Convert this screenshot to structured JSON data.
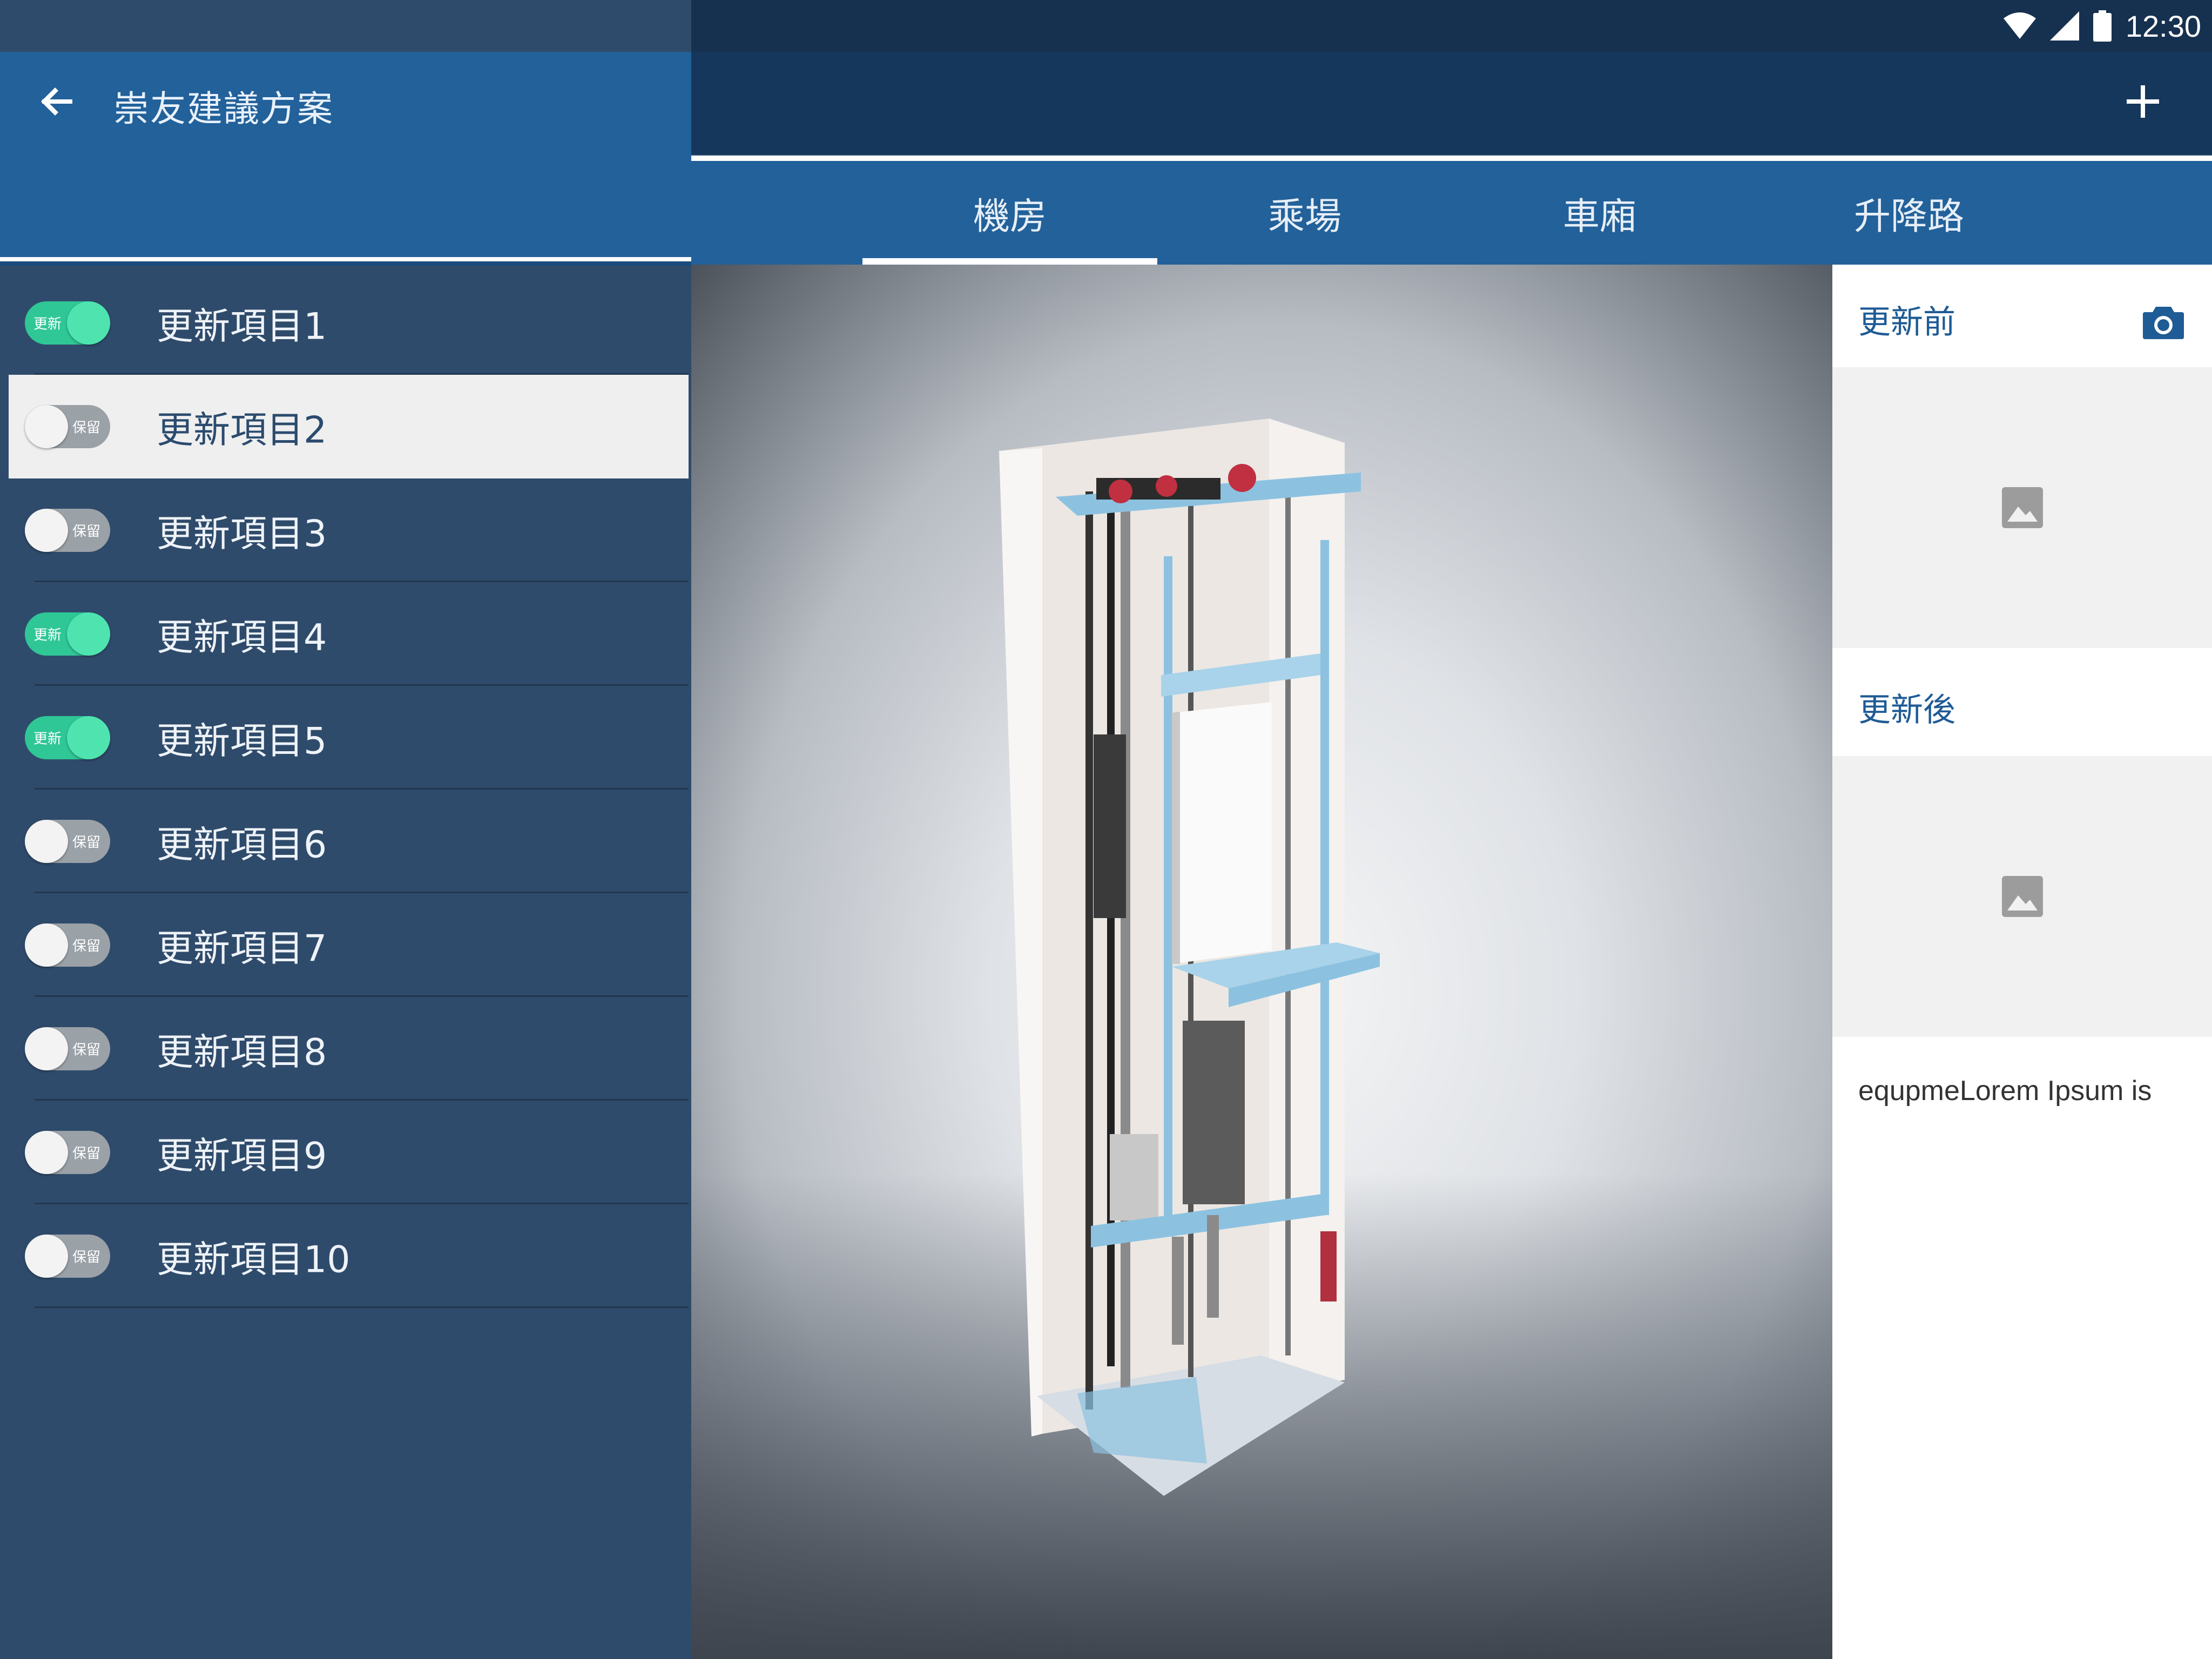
{
  "status_bar": {
    "time": "12:30",
    "icons": [
      "wifi-icon",
      "signal-icon",
      "battery-icon"
    ]
  },
  "drawer": {
    "title": "崇友建議方案",
    "items": [
      {
        "label": "更新項目1",
        "toggle_on": true,
        "toggle_text": "更新"
      },
      {
        "label": "更新項目2",
        "toggle_on": false,
        "toggle_text": "保留",
        "selected": true
      },
      {
        "label": "更新項目3",
        "toggle_on": false,
        "toggle_text": "保留"
      },
      {
        "label": "更新項目4",
        "toggle_on": true,
        "toggle_text": "更新"
      },
      {
        "label": "更新項目5",
        "toggle_on": true,
        "toggle_text": "更新"
      },
      {
        "label": "更新項目6",
        "toggle_on": false,
        "toggle_text": "保留"
      },
      {
        "label": "更新項目7",
        "toggle_on": false,
        "toggle_text": "保留"
      },
      {
        "label": "更新項目8",
        "toggle_on": false,
        "toggle_text": "保留"
      },
      {
        "label": "更新項目9",
        "toggle_on": false,
        "toggle_text": "保留"
      },
      {
        "label": "更新項目10",
        "toggle_on": false,
        "toggle_text": "保留"
      }
    ]
  },
  "tabs": [
    {
      "label": "機房",
      "active": true
    },
    {
      "label": "乘場",
      "active": false
    },
    {
      "label": "車廂",
      "active": false
    },
    {
      "label": "升降路",
      "active": false
    }
  ],
  "right_panel": {
    "before_title": "更新前",
    "after_title": "更新後",
    "description": "equpmeLorem Ipsum is"
  },
  "colors": {
    "primary": "#22619a",
    "primary_dark": "#15375c",
    "drawer_bg": "#2f4b6b",
    "toggle_on": "#2fc796",
    "toggle_off": "#9aa1a7"
  }
}
